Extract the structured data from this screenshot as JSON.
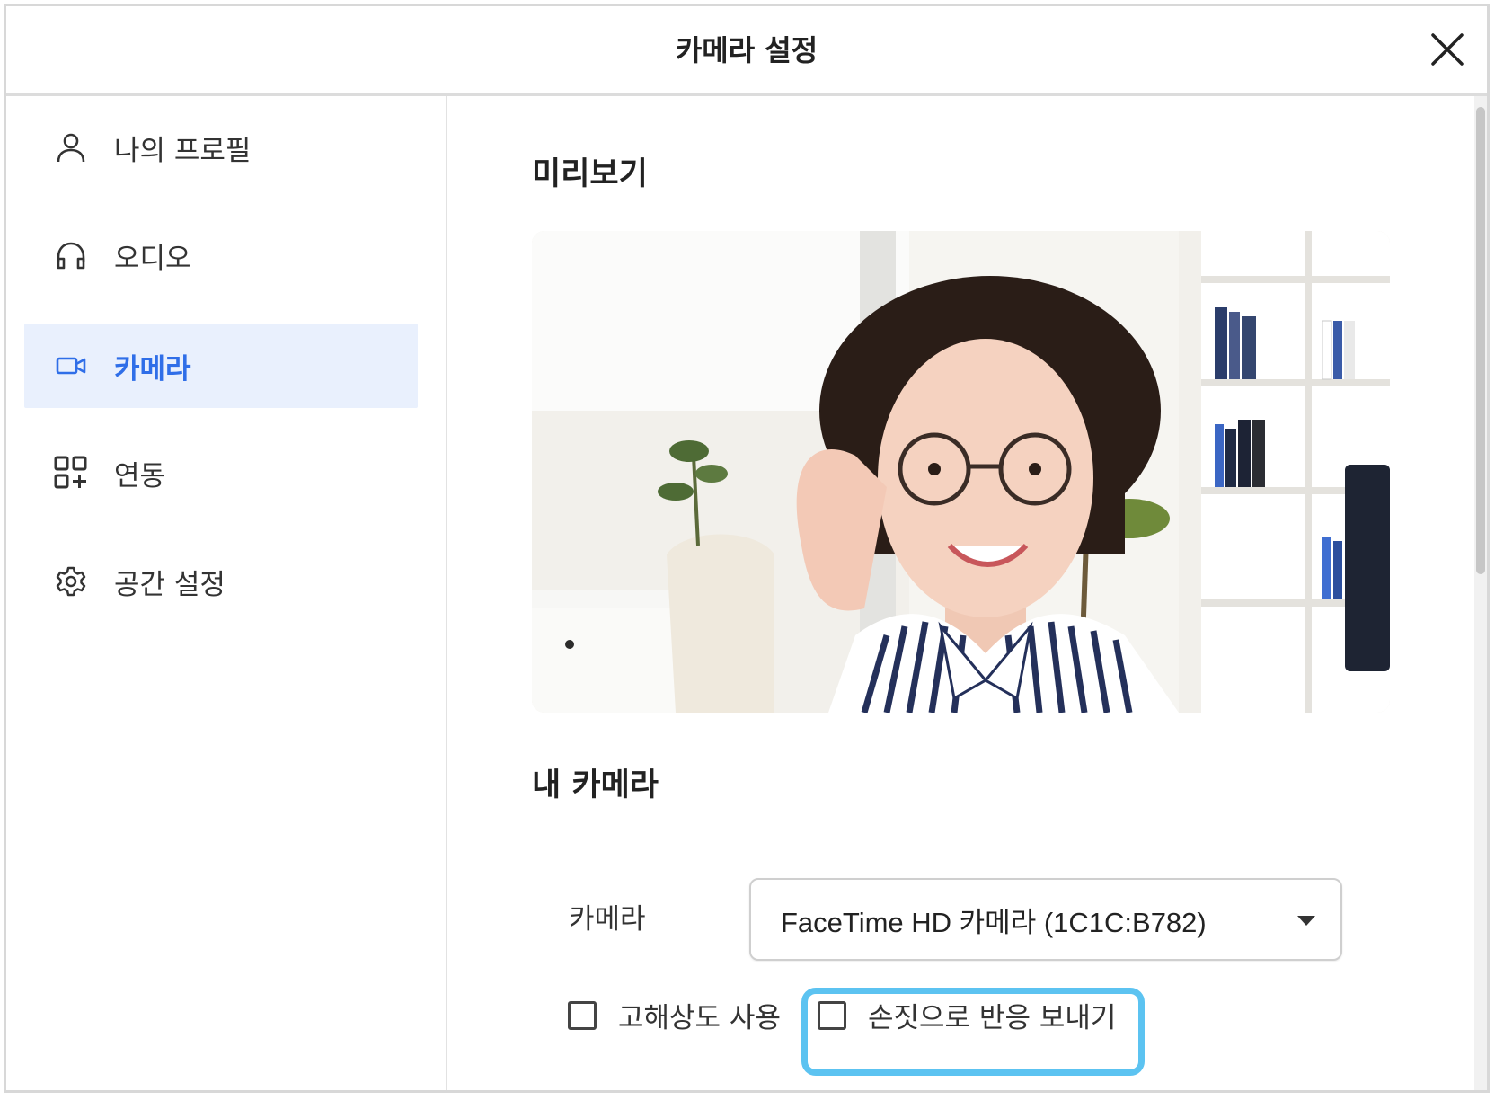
{
  "window": {
    "title": "카메라 설정"
  },
  "sidebar": {
    "items": [
      {
        "label": "나의 프로필",
        "icon": "person-icon",
        "active": false
      },
      {
        "label": "오디오",
        "icon": "headphones-icon",
        "active": false
      },
      {
        "label": "카메라",
        "icon": "camera-icon",
        "active": true
      },
      {
        "label": "연동",
        "icon": "apps-add-icon",
        "active": false
      },
      {
        "label": "공간 설정",
        "icon": "gear-icon",
        "active": false
      }
    ]
  },
  "preview": {
    "title": "미리보기"
  },
  "my_camera": {
    "title": "내 카메라",
    "camera_label": "카메라",
    "camera_selected": "FaceTime HD 카메라 (1C1C:B782)",
    "high_res_label": "고해상도 사용",
    "high_res_checked": false,
    "gesture_label": "손짓으로 반응 보내기",
    "gesture_checked": false
  },
  "colors": {
    "accent": "#2f6ee8",
    "active_bg": "#e9f0fd",
    "highlight": "#5cc3f1"
  }
}
